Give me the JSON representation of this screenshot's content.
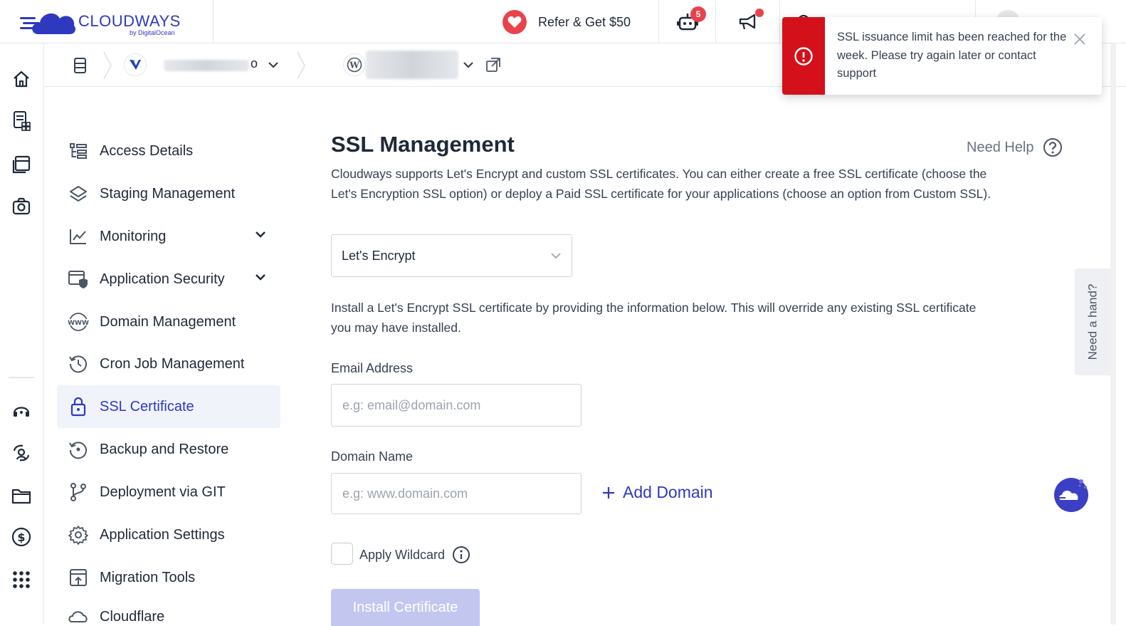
{
  "brand": {
    "name": "CLOUDWAYS",
    "sub": "by DigitalOcean",
    "color": "#2f39bf"
  },
  "topbar": {
    "refer_label": "Refer & Get $50",
    "bot_badge": "5",
    "icons": [
      "heart-icon",
      "robot-icon",
      "megaphone-icon",
      "search-icon",
      "avatar"
    ]
  },
  "rail": {
    "icons": [
      "home-icon",
      "servers-icon",
      "applications-icon",
      "addons-icon",
      "support-icon",
      "team-icon",
      "projects-icon",
      "billing-icon",
      "apps-grid-icon"
    ]
  },
  "breadcrumb": {
    "icons": [
      "server-list-icon",
      "vultr-icon",
      "chevron-down-icon",
      "wordpress-icon",
      "chevron-down-icon",
      "external-link-icon"
    ],
    "server_name_suffix": "o"
  },
  "sidebar": {
    "items": [
      {
        "label": "Access Details",
        "icon": "access-details-icon"
      },
      {
        "label": "Staging Management",
        "icon": "layers-icon"
      },
      {
        "label": "Monitoring",
        "icon": "chart-line-icon",
        "expandable": true
      },
      {
        "label": "Application Security",
        "icon": "shield-window-icon",
        "expandable": true
      },
      {
        "label": "Domain Management",
        "icon": "www-icon"
      },
      {
        "label": "Cron Job Management",
        "icon": "history-icon"
      },
      {
        "label": "SSL Certificate",
        "icon": "lock-icon",
        "active": true
      },
      {
        "label": "Backup and Restore",
        "icon": "backup-icon"
      },
      {
        "label": "Deployment via GIT",
        "icon": "git-branch-icon"
      },
      {
        "label": "Application Settings",
        "icon": "gear-icon"
      },
      {
        "label": "Migration Tools",
        "icon": "migration-icon"
      },
      {
        "label": "Cloudflare",
        "icon": "cloudflare-icon"
      }
    ]
  },
  "main": {
    "title": "SSL Management",
    "help_label": "Need Help",
    "intro": "Cloudways supports Let's Encrypt and custom SSL certificates. You can either create a free SSL certificate (choose the Let's Encryption SSL option) or deploy a Paid SSL certificate for your applications (choose an option from Custom SSL).",
    "ssl_type_selected": "Let's Encrypt",
    "install_info": "Install a Let's Encrypt SSL certificate by providing the information below. This will override any existing SSL certificate you may have installed.",
    "email_label": "Email Address",
    "email_placeholder": "e.g: email@domain.com",
    "domain_label": "Domain Name",
    "domain_placeholder": "e.g: www.domain.com",
    "add_domain_label": "Add Domain",
    "wildcard_label": "Apply Wildcard",
    "wildcard_checked": false,
    "install_button": "Install Certificate"
  },
  "toast": {
    "message": "SSL issuance limit has been reached for the week. Please try again later or contact support",
    "color": "#d4111b"
  },
  "need_hand": "Need a hand?"
}
